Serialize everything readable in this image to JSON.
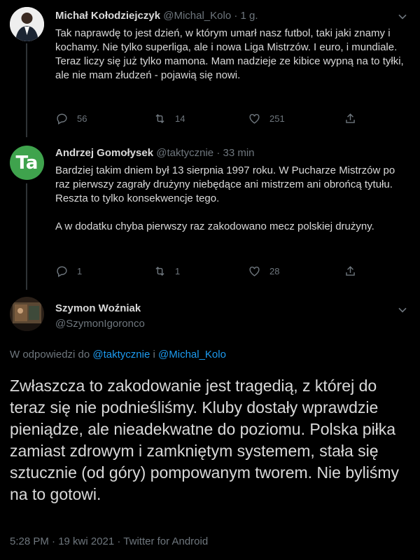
{
  "tweets": [
    {
      "name": "Michał Kołodziejczyk",
      "handle": "@Michal_Kolo",
      "time": "· 1 g.",
      "text": "Tak naprawdę to jest dzień, w którym umarł nasz futbol, taki jaki znamy i kochamy. Nie tylko superliga, ale i nowa Liga Mistrzów. I euro, i mundiale. Teraz liczy się już tylko mamona. Mam nadzieje ze kibice wypną na to tyłki, ale nie mam złudzeń - pojawią się nowi.",
      "replies": "56",
      "retweets": "14",
      "likes": "251"
    },
    {
      "name": "Andrzej Gomołysek",
      "handle": "@taktycznie",
      "time": "· 33 min",
      "text_p1": "Bardziej takim dniem był 13 sierpnia 1997 roku. W Pucharze Mistrzów po raz pierwszy zagrały drużyny niebędące ani mistrzem ani obrońcą tytułu. Reszta to tylko konsekwencje tego.",
      "text_p2": "A w dodatku chyba pierwszy raz zakodowano mecz polskiej drużyny.",
      "avatar_text": "Ta",
      "replies": "1",
      "retweets": "1",
      "likes": "28"
    }
  ],
  "main_tweet": {
    "name": "Szymon Woźniak",
    "handle": "@SzymonIgoronco",
    "reply_prefix": "W odpowiedzi do",
    "reply_mention1": "@taktycznie",
    "reply_joiner": "i",
    "reply_mention2": "@Michal_Kolo",
    "text": "Zwłaszcza to zakodowanie jest tragedią, z której do teraz się nie podnieśliśmy. Kluby dostały wprawdzie pieniądze, ale nieadekwatne do poziomu. Polska piłka zamiast zdrowym i zamkniętym systemem, stała się sztucznie (od góry) pompowanym tworem. Nie byliśmy na to gotowi.",
    "timestamp": "5:28 PM · 19 kwi 2021 · Twitter for Android"
  },
  "colors": {
    "background": "#000000",
    "text": "#d9d9d9",
    "secondary": "#6e767d",
    "accent": "#1d9bf0",
    "divider": "#2f3336",
    "avatar_green": "#3fa34d"
  }
}
